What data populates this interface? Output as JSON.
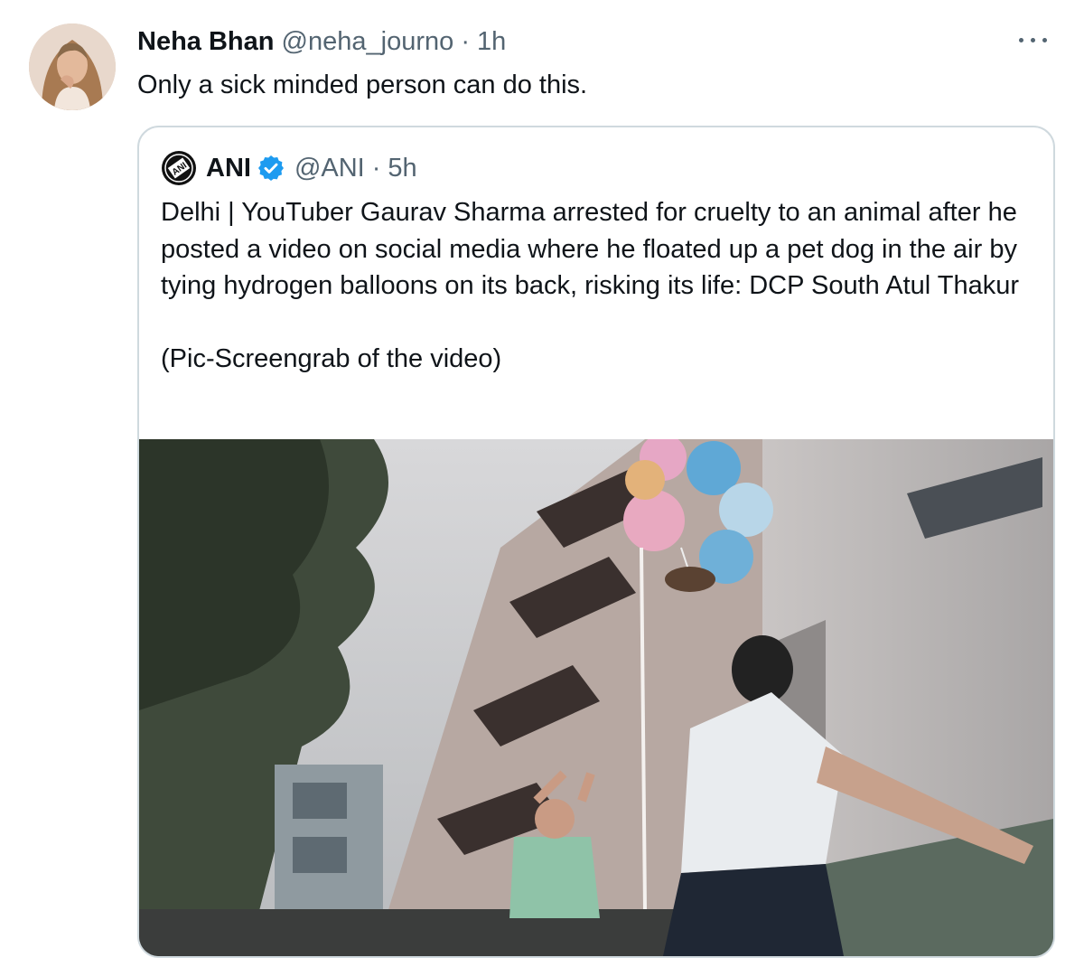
{
  "tweet": {
    "author_name": "Neha Bhan",
    "author_handle": "@neha_journo",
    "separator": "·",
    "time": "1h",
    "text": "Only a sick minded person can do this.",
    "avatar_icon": "user-avatar",
    "more_icon": "more-options-icon"
  },
  "quoted_tweet": {
    "author_name": "ANI",
    "author_handle": "@ANI",
    "separator": "·",
    "time": "5h",
    "logo_text": "ANI",
    "verified_icon": "verified-badge-icon",
    "verified_color": "#1d9bf0",
    "text": "Delhi | YouTuber Gaurav Sharma arrested for cruelty to an animal after he posted a video on social media where he floated up a pet dog in the air by tying hydrogen balloons on its back, risking its life: DCP South Atul Thakur\n\n(Pic-Screengrab of the video)",
    "media_description_icon": "video-screengrab-image"
  },
  "colors": {
    "text_primary": "#0f1419",
    "text_secondary": "#536471",
    "border": "#cfd9de",
    "verified": "#1d9bf0"
  }
}
